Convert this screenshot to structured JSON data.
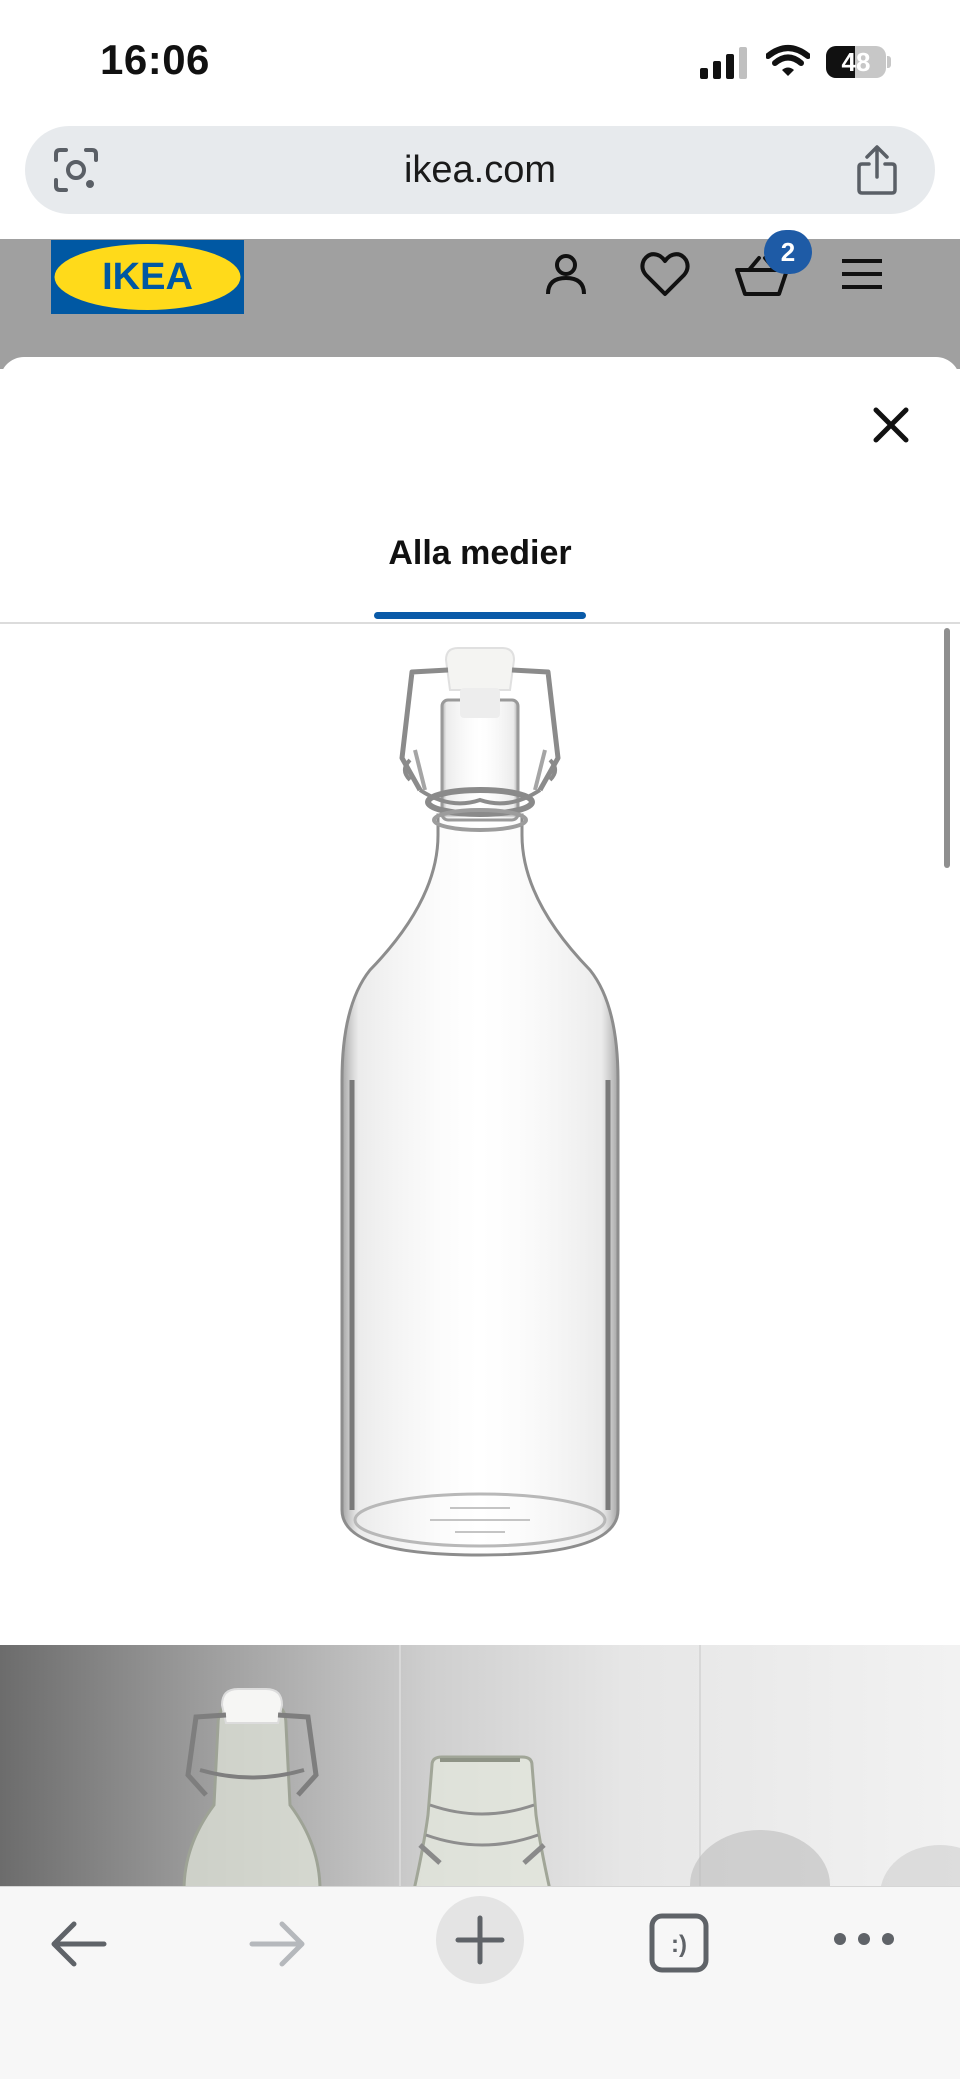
{
  "status_bar": {
    "time": "16:06",
    "battery_percent": "48",
    "battery_level": 0.48
  },
  "browser": {
    "url": "ikea.com"
  },
  "site_header": {
    "logo_text": "IKEA",
    "cart_count": "2",
    "brand_colors": {
      "blue": "#0058a3",
      "yellow": "#ffda1a"
    }
  },
  "media_viewer": {
    "tab_label": "Alla medier"
  },
  "toolbar": {
    "tabs_icon_glyph": ":)"
  },
  "icons": [
    "lens-icon",
    "share-icon",
    "account-icon",
    "heart-icon",
    "cart-icon",
    "menu-icon",
    "close-icon",
    "back-arrow-icon",
    "forward-arrow-icon",
    "plus-icon",
    "tabs-icon",
    "more-dots-icon"
  ]
}
